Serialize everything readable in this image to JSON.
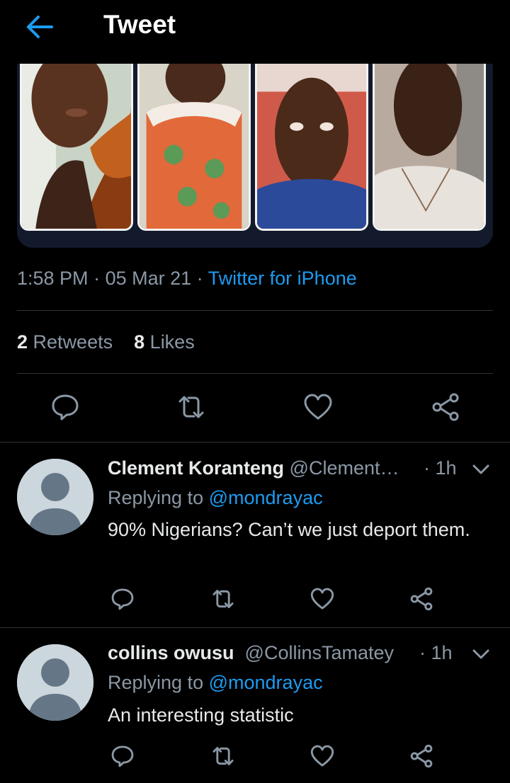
{
  "header": {
    "title": "Tweet",
    "back_icon": "arrow-left-icon",
    "accent": "#1d9bf0"
  },
  "tweet": {
    "time": "1:58 PM",
    "date": "05 Mar 21",
    "separator": " · ",
    "source": "Twitter for iPhone",
    "retweets_count": "2",
    "retweets_label": "Retweets",
    "likes_count": "8",
    "likes_label": "Likes",
    "actions": [
      "reply-icon",
      "retweet-icon",
      "like-icon",
      "share-icon"
    ]
  },
  "replies": [
    {
      "name": "Clement Koranteng",
      "handle": "@Clement…",
      "time": "· 1h",
      "replying_prefix": "Replying to",
      "mention": "@mondrayac",
      "text": "90% Nigerians? Can’t we just deport them."
    },
    {
      "name": "collins owusu",
      "handle": "@CollinsTamatey",
      "time": "· 1h",
      "replying_prefix": "Replying to",
      "mention": "@mondrayac",
      "text": "An interesting statistic"
    }
  ]
}
